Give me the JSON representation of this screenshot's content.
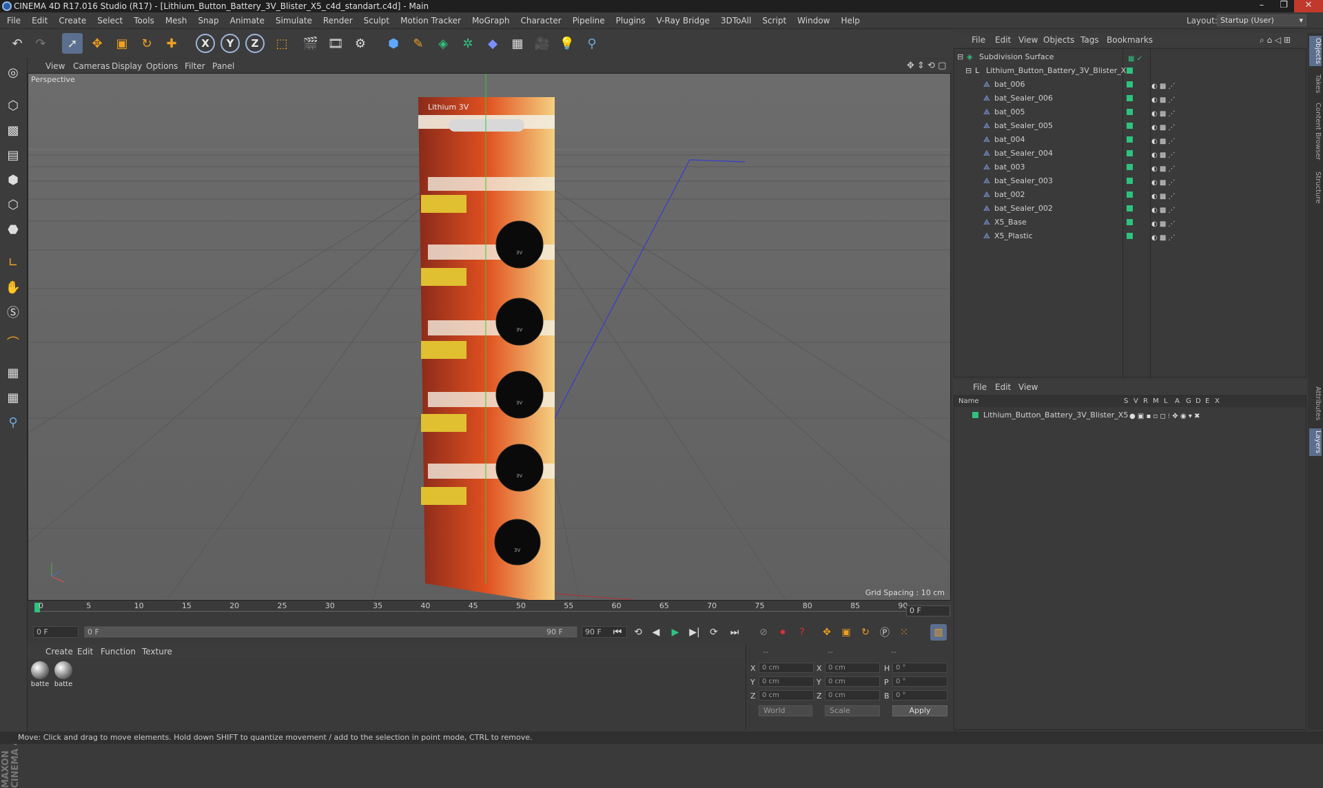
{
  "window": {
    "title": "CINEMA 4D R17.016 Studio (R17) - [Lithium_Button_Battery_3V_Blister_X5_c4d_standart.c4d] - Main",
    "buttons": [
      "–",
      "❐",
      "✕"
    ]
  },
  "menubar": {
    "items": [
      "File",
      "Edit",
      "Create",
      "Select",
      "Tools",
      "Mesh",
      "Snap",
      "Animate",
      "Simulate",
      "Render",
      "Sculpt",
      "Motion Tracker",
      "MoGraph",
      "Character",
      "Pipeline",
      "Plugins",
      "V-Ray Bridge",
      "3DToAll",
      "Script",
      "Window",
      "Help"
    ],
    "layout_label": "Layout:",
    "layout_value": "Startup (User)"
  },
  "toolbar": {
    "axis_x": "X",
    "axis_y": "Y",
    "axis_z": "Z"
  },
  "viewport": {
    "menu": [
      "View",
      "Cameras",
      "Display",
      "Options",
      "Filter",
      "Panel"
    ],
    "label": "Perspective",
    "grid_spacing": "Grid Spacing : 10 cm",
    "card_text": "Lithium 3V",
    "cell_text": "3V"
  },
  "timeline": {
    "ticks": [
      "0",
      "5",
      "10",
      "15",
      "20",
      "25",
      "30",
      "35",
      "40",
      "45",
      "50",
      "55",
      "60",
      "65",
      "70",
      "75",
      "80",
      "85",
      "90"
    ],
    "end_frame": "0 F"
  },
  "transport": {
    "start_field": "0 F",
    "range_start": "0 F",
    "range_end": "90 F",
    "end_field": "90 F"
  },
  "materials": {
    "menu": [
      "Create",
      "Edit",
      "Function",
      "Texture"
    ],
    "items": [
      "batte",
      "batte"
    ]
  },
  "coordinates": {
    "headers": [
      "--",
      "--",
      "--"
    ],
    "rows": [
      {
        "a": "X",
        "av": "0 cm",
        "b": "X",
        "bv": "0 cm",
        "c": "H",
        "cv": "0 °"
      },
      {
        "a": "Y",
        "av": "0 cm",
        "b": "Y",
        "bv": "0 cm",
        "c": "P",
        "cv": "0 °"
      },
      {
        "a": "Z",
        "av": "0 cm",
        "b": "Z",
        "bv": "0 cm",
        "c": "B",
        "cv": "0 °"
      }
    ],
    "world": "World",
    "scale": "Scale",
    "apply": "Apply"
  },
  "status": "Move: Click and drag to move elements. Hold down SHIFT to quantize movement / add to the selection in point mode, CTRL to remove.",
  "object_manager": {
    "menu": [
      "File",
      "Edit",
      "View",
      "Objects",
      "Tags",
      "Bookmarks"
    ],
    "root": "Subdivision Surface",
    "group": "Lithium_Button_Battery_3V_Blister_X5",
    "children": [
      "bat_006",
      "bat_Sealer_006",
      "bat_005",
      "bat_Sealer_005",
      "bat_004",
      "bat_Sealer_004",
      "bat_003",
      "bat_Sealer_003",
      "bat_002",
      "bat_Sealer_002",
      "X5_Base",
      "X5_Plastic"
    ]
  },
  "layer_manager": {
    "menu": [
      "File",
      "Edit",
      "View"
    ],
    "columns": [
      "Name",
      "S",
      "V",
      "R",
      "M",
      "L",
      "A",
      "G",
      "D",
      "E",
      "X"
    ],
    "layer": "Lithium_Button_Battery_3V_Blister_X5"
  },
  "side_tabs": [
    "Objects",
    "Takes",
    "Content Browser",
    "Structure",
    "Attributes",
    "Layers"
  ],
  "maxon_logo": "MAXON CINEMA 4D",
  "colors": {
    "layer_green": "#2ec27e",
    "accent_blue": "#5b6f8e"
  }
}
